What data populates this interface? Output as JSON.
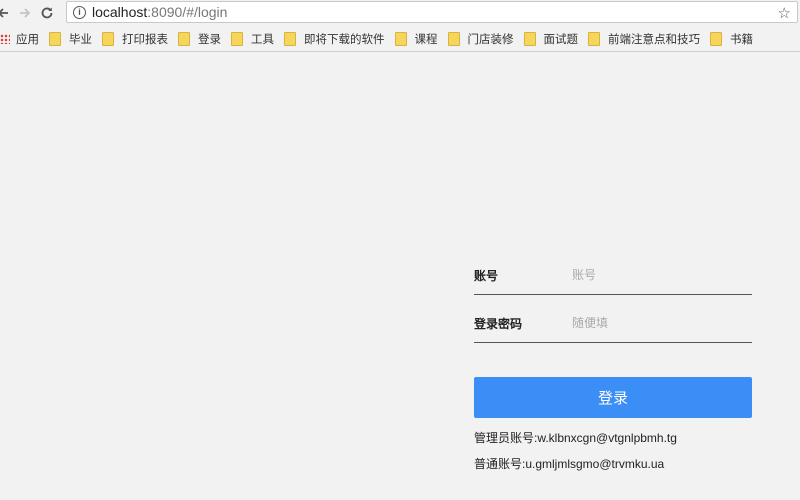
{
  "browser": {
    "url_host": "localhost",
    "url_rest": ":8090/#/login",
    "back_icon": "arrow-left-icon",
    "forward_icon": "arrow-right-icon",
    "reload_icon": "reload-icon",
    "info_icon": "info-icon",
    "bookmark_star_icon": "star-icon"
  },
  "bookmarks": {
    "apps_label": "应用",
    "items": [
      {
        "label": "毕业"
      },
      {
        "label": "打印报表"
      },
      {
        "label": "登录"
      },
      {
        "label": "工具"
      },
      {
        "label": "即将下载的软件"
      },
      {
        "label": "课程"
      },
      {
        "label": "门店装修"
      },
      {
        "label": "面试题"
      },
      {
        "label": "前端注意点和技巧"
      },
      {
        "label": "书籍"
      }
    ]
  },
  "login": {
    "account_label": "账号",
    "account_placeholder": "账号",
    "password_label": "登录密码",
    "password_placeholder": "随便填",
    "submit_label": "登录",
    "admin_hint": "管理员账号:w.klbnxcgn@vtgnlpbmh.tg",
    "user_hint": "普通账号:u.gmljmlsgmo@trvmku.ua"
  },
  "colors": {
    "primary_button": "#3a8ef6",
    "page_background": "#f2f2f2"
  }
}
